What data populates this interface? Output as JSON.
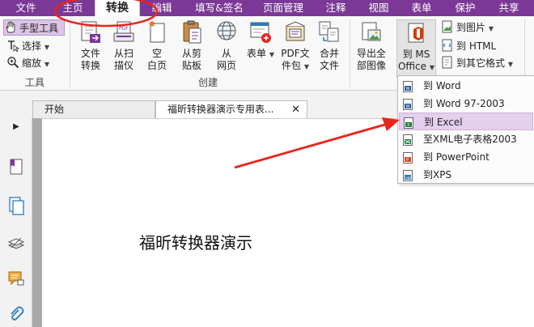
{
  "menu": {
    "tabs": [
      "文件",
      "主页",
      "转换",
      "编辑",
      "填写&签名",
      "页面管理",
      "注释",
      "视图",
      "表单",
      "保护",
      "共享"
    ],
    "active_index": 2
  },
  "ribbon": {
    "tools": {
      "hand_tool": "手型工具",
      "select": "选择",
      "zoom": "缩放",
      "group_label": "工具"
    },
    "create": {
      "file_convert": "文件\n转换",
      "from_scanner": "从扫\n描仪",
      "blank_page": "空\n白页",
      "from_clipboard": "从剪\n贴板",
      "from_web": "从\n网页",
      "form": "表单",
      "pdf_package": "PDF文\n件包",
      "merge_files": "合并\n文件",
      "group_label": "创建"
    },
    "export": {
      "export_all_images": "导出全\n部图像",
      "to_ms_office": "到 MS\nOffice",
      "to_image": "到图片",
      "to_html": "到 HTML",
      "to_other_format": "到其它格式"
    }
  },
  "tabs": {
    "start": "开始",
    "document": "福昕转换器演示专用表..."
  },
  "document": {
    "text": "福昕转换器演示"
  },
  "dropdown": {
    "items": [
      "到 Word",
      "到 Word 97-2003",
      "到 Excel",
      "至XML电子表格2003",
      "到 PowerPoint",
      "到XPS"
    ],
    "selected_index": 2
  },
  "colors": {
    "menubar": "#7b3896",
    "annotation_red": "#e8241c",
    "excel_green": "#1f7a45",
    "word_blue": "#2b579a",
    "ppt_orange": "#d24726",
    "office_red": "#d83b01"
  }
}
